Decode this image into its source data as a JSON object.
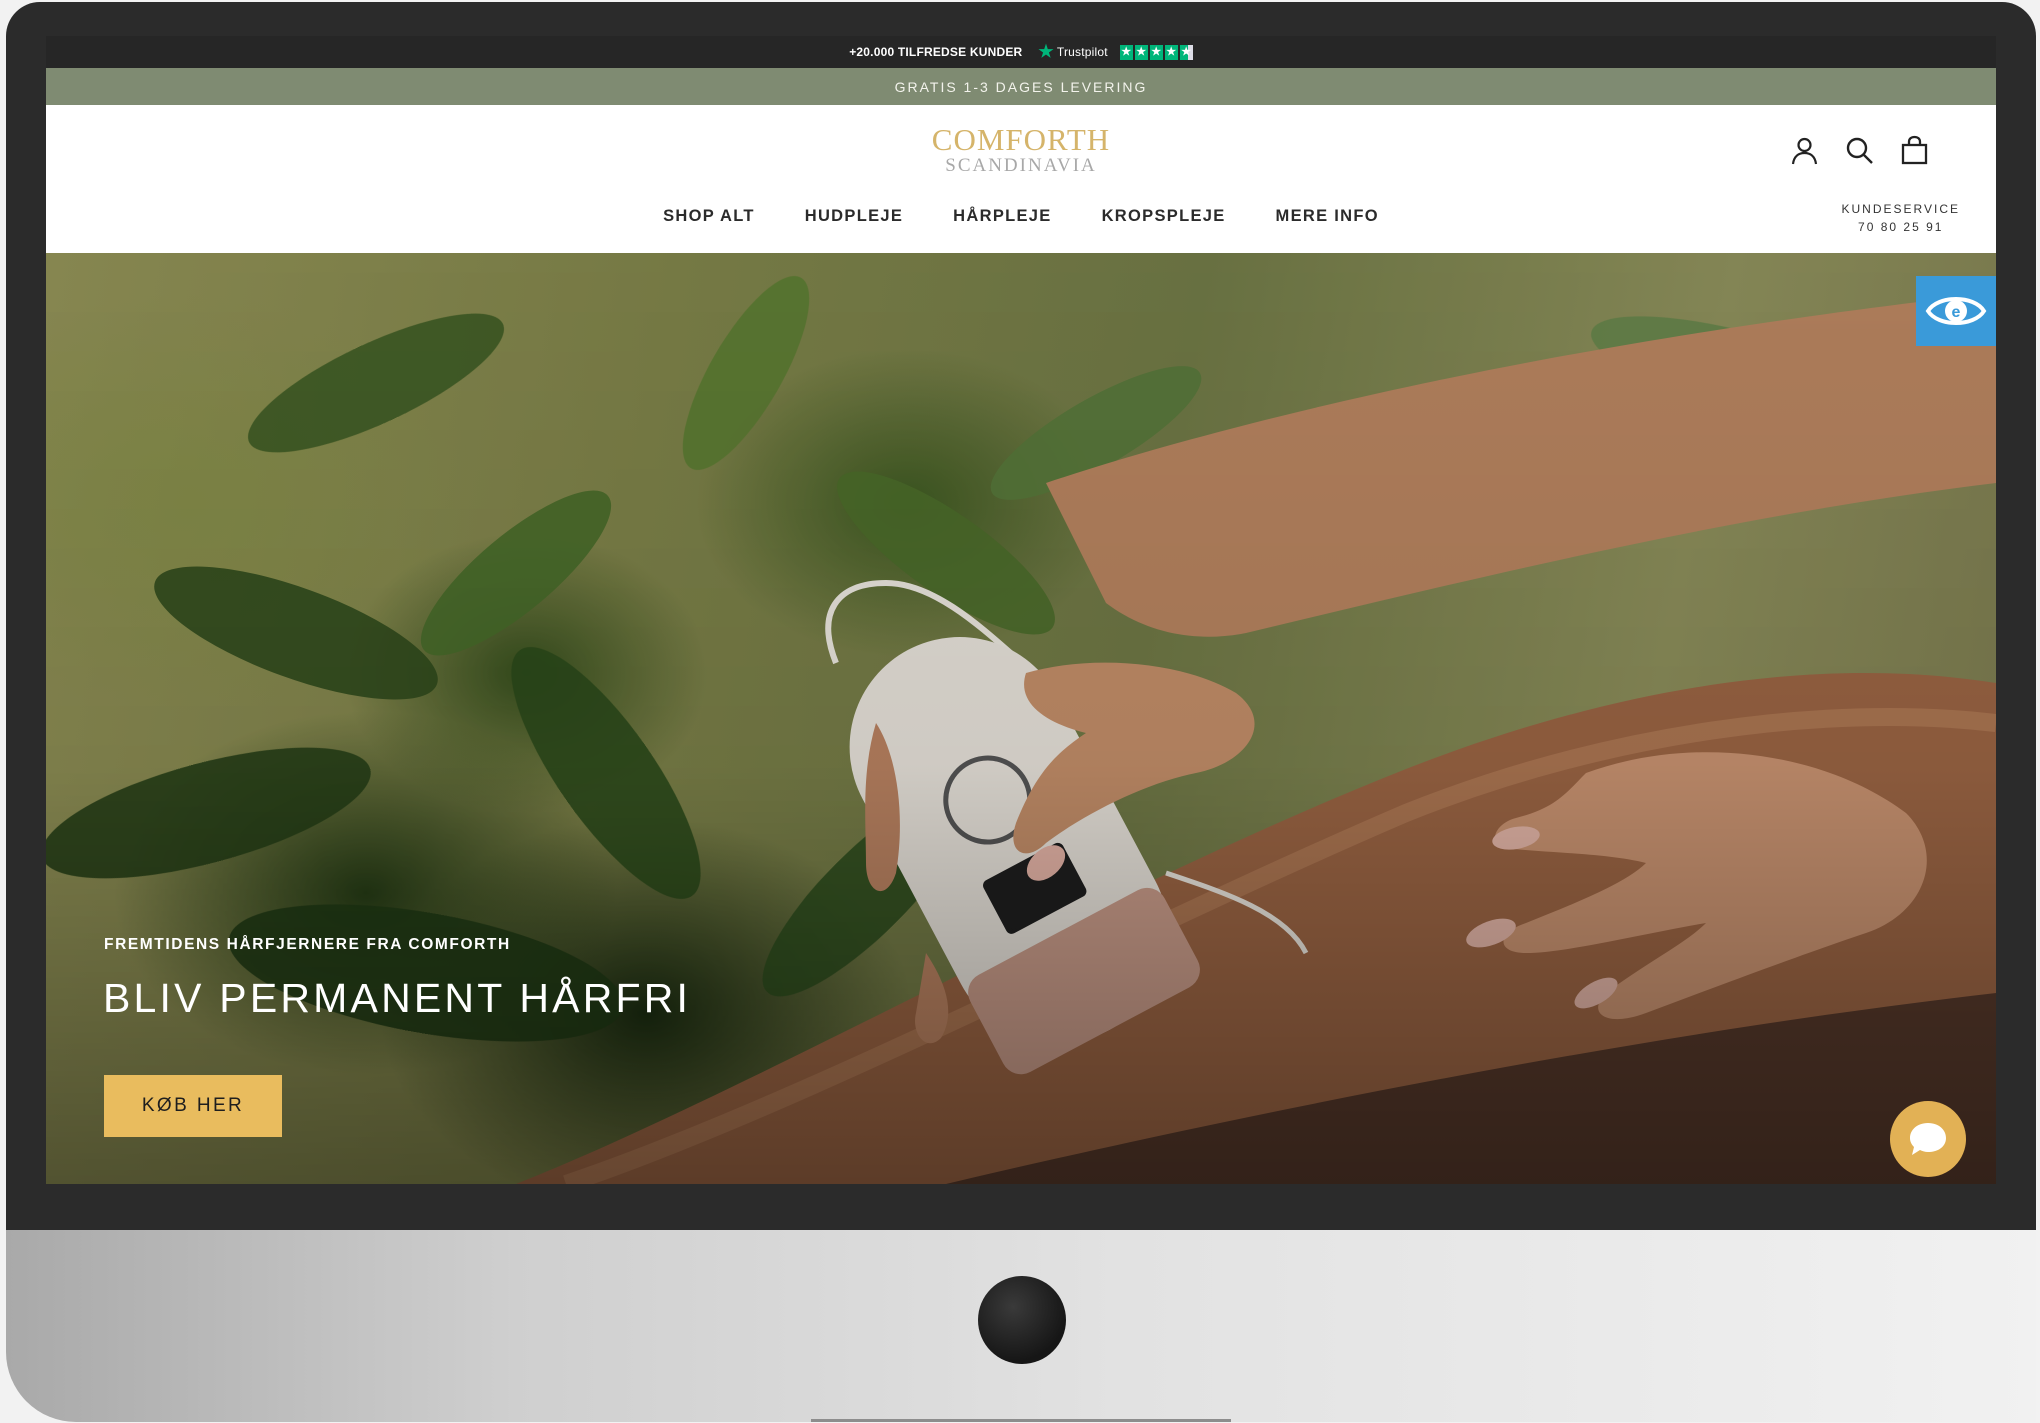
{
  "topbar": {
    "customers": "+20.000 TILFREDSE KUNDER",
    "review_site": "Trustpilot",
    "rating": 4.5
  },
  "shipping_bar": {
    "text": "GRATIS 1-3 DAGES LEVERING"
  },
  "header": {
    "logo_main": "COMFORTH",
    "logo_sub": "SCANDINAVIA",
    "icons": [
      "account-icon",
      "search-icon",
      "bag-icon"
    ],
    "nav": [
      {
        "label": "SHOP ALT"
      },
      {
        "label": "HUDPLEJE"
      },
      {
        "label": "HÅRPLEJE"
      },
      {
        "label": "KROPSPLEJE"
      },
      {
        "label": "MERE INFO"
      }
    ],
    "customer_service_label": "KUNDESERVICE",
    "customer_service_phone": "70 80 25 91"
  },
  "hero": {
    "subtitle": "FREMTIDENS HÅRFJERNERE FRA COMFORTH",
    "title": "BLIV PERMANENT HÅRFRI",
    "cta": "KØB HER",
    "slides": 3,
    "active_slide": 1
  },
  "colors": {
    "accent": "#e9bc5e",
    "shipping_bar": "#7f8b72",
    "logo": "#d5b46a",
    "accessibility": "#3a9ad9"
  }
}
